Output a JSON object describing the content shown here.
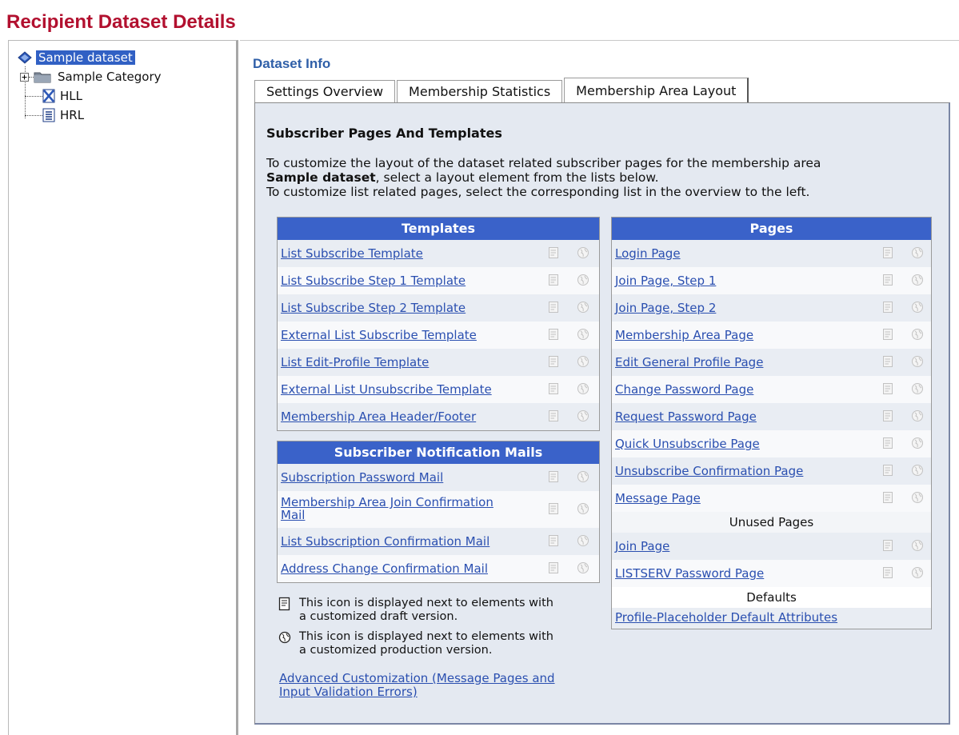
{
  "page_title": "Recipient Dataset Details",
  "tree": {
    "root": "Sample dataset",
    "items": [
      {
        "label": "Sample Category",
        "icon": "folder-icon"
      },
      {
        "label": "HLL",
        "icon": "list-hll-icon"
      },
      {
        "label": "HRL",
        "icon": "list-hrl-icon"
      }
    ]
  },
  "section_title": "Dataset Info",
  "tabs": [
    "Settings Overview",
    "Membership Statistics",
    "Membership Area Layout"
  ],
  "active_tab": "Membership Area Layout",
  "content": {
    "heading": "Subscriber Pages And Templates",
    "desc_line1": "To customize the layout of the dataset related subscriber pages for the membership area",
    "desc_bold": "Sample dataset",
    "desc_line2_rest": ", select a layout element from the lists below.",
    "desc_line3": "To customize list related pages, select the corresponding list in the overview to the left."
  },
  "templates": {
    "header": "Templates",
    "items": [
      "List Subscribe Template",
      "List Subscribe Step 1 Template",
      "List Subscribe Step 2 Template",
      "External List Subscribe Template",
      "List Edit-Profile Template",
      "External List Unsubscribe Template",
      "Membership Area Header/Footer"
    ]
  },
  "notification_mails": {
    "header": "Subscriber Notification Mails",
    "items": [
      "Subscription Password Mail",
      "Membership Area Join Confirmation Mail",
      "List Subscription Confirmation Mail",
      "Address Change Confirmation Mail"
    ]
  },
  "pages": {
    "header": "Pages",
    "items": [
      "Login Page",
      "Join Page, Step 1",
      "Join Page, Step 2",
      "Membership Area Page",
      "Edit General Profile Page",
      "Change Password Page",
      "Request Password Page",
      "Quick Unsubscribe Page",
      "Unsubscribe Confirmation Page",
      "Message Page"
    ],
    "unused_label": "Unused Pages",
    "unused_items": [
      "Join Page",
      "LISTSERV Password Page"
    ],
    "defaults_label": "Defaults",
    "defaults_link": "Profile-Placeholder Default Attributes"
  },
  "legend": {
    "draft_line1": "This icon is displayed next to elements with",
    "draft_line2": "a customized draft version.",
    "prod_line1": "This icon is displayed next to elements with",
    "prod_line2": "a customized production version."
  },
  "advanced_link_line1": "Advanced Customization (Message Pages and",
  "advanced_link_line2": "Input Validation Errors)"
}
